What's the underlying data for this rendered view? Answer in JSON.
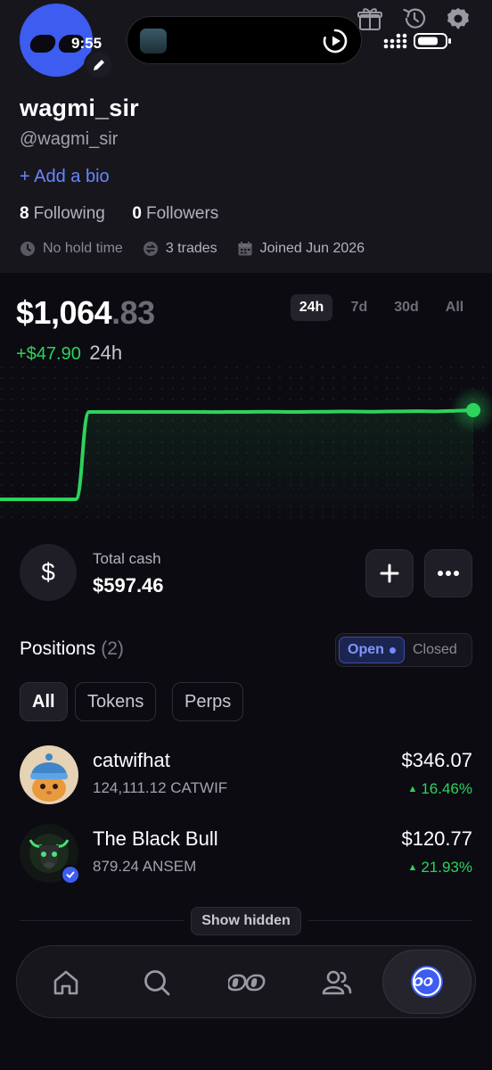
{
  "status_bar": {
    "time": "9:55"
  },
  "profile": {
    "username": "wagmi_sir",
    "handle": "@wagmi_sir",
    "add_bio": "+ Add a bio",
    "following_count": "8",
    "following_label": "Following",
    "followers_count": "0",
    "followers_label": "Followers",
    "hold_time": "No hold time",
    "trades": "3 trades",
    "joined": "Joined Jun 2026",
    "avatar_color": "#3d5cf0"
  },
  "portfolio": {
    "balance_whole": "$1,064",
    "balance_cents": ".83",
    "change_amount": "+$47.90",
    "change_period": "24h",
    "ranges": [
      "24h",
      "7d",
      "30d",
      "All"
    ],
    "active_range": "24h",
    "accent_color": "#2cd35c"
  },
  "chart_data": {
    "type": "line",
    "title": "",
    "xlabel": "",
    "ylabel": "",
    "x": [
      "t0",
      "t1",
      "t2",
      "t3",
      "t4",
      "t5",
      "t6",
      "t7",
      "t8",
      "t9",
      "t10",
      "t11",
      "t12",
      "t13",
      "t14",
      "t15",
      "t16",
      "t17",
      "t18",
      "t19",
      "t20"
    ],
    "values": [
      1016.93,
      1016.93,
      1016.93,
      1016.93,
      1063.9,
      1063.9,
      1063.9,
      1063.9,
      1063.8,
      1063.9,
      1064.0,
      1063.9,
      1064.0,
      1064.1,
      1064.0,
      1064.2,
      1064.3,
      1064.2,
      1064.4,
      1064.6,
      1064.83
    ],
    "ylim": [
      1000,
      1080
    ],
    "grid": false
  },
  "cash": {
    "label": "Total cash",
    "value": "$597.46",
    "icon": "dollar-icon"
  },
  "positions": {
    "title": "Positions",
    "count": "(2)",
    "toggle_open": "Open",
    "toggle_closed": "Closed",
    "filters": [
      "All",
      "Tokens",
      "Perps"
    ],
    "items": [
      {
        "name": "catwifhat",
        "amount": "124,111.12 CATWIF",
        "value": "$346.07",
        "change": "16.46%"
      },
      {
        "name": "The Black Bull",
        "amount": "879.24 ANSEM",
        "value": "$120.77",
        "change": "21.93%"
      }
    ],
    "show_hidden": "Show hidden"
  },
  "bottom_nav": {
    "items": [
      "home-icon",
      "search-icon",
      "pills-icon",
      "users-icon",
      "profile-icon"
    ],
    "active": "profile-icon"
  }
}
